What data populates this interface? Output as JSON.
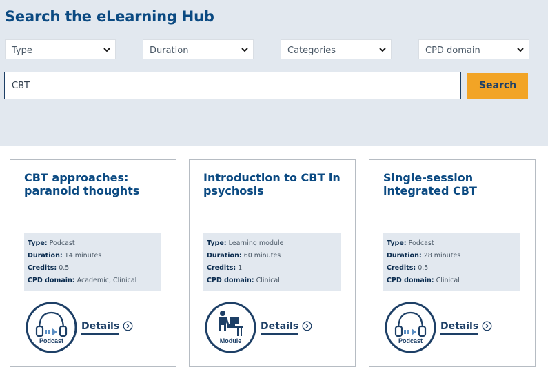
{
  "header": {
    "title": "Search the eLearning Hub"
  },
  "filters": [
    {
      "label": "Type"
    },
    {
      "label": "Duration"
    },
    {
      "label": "Categories"
    },
    {
      "label": "CPD domain"
    }
  ],
  "search": {
    "value": "CBT",
    "button_label": "Search"
  },
  "field_labels": {
    "type": "Type:",
    "duration": "Duration:",
    "credits": "Credits:",
    "cpd": "CPD domain:"
  },
  "cards": [
    {
      "title": "CBT approaches: paranoid thoughts",
      "type": "Podcast",
      "duration": "14 minutes",
      "credits": "0.5",
      "cpd": "Academic, Clinical",
      "badge": "Podcast",
      "badge_icon": "headphones-icon",
      "details_label": "Details"
    },
    {
      "title": "Introduction to CBT in psychosis",
      "type": "Learning module",
      "duration": "60 minutes",
      "credits": "1",
      "cpd": "Clinical",
      "badge": "Module",
      "badge_icon": "person-at-computer-icon",
      "details_label": "Details"
    },
    {
      "title": "Single-session integrated CBT",
      "type": "Podcast",
      "duration": "28 minutes",
      "credits": "0.5",
      "cpd": "Clinical",
      "badge": "Podcast",
      "badge_icon": "headphones-icon",
      "details_label": "Details"
    }
  ],
  "colors": {
    "brand": "#0b4a82",
    "panel": "#e2e8ef",
    "accent": "#f2a426",
    "navy": "#1d3f66"
  }
}
